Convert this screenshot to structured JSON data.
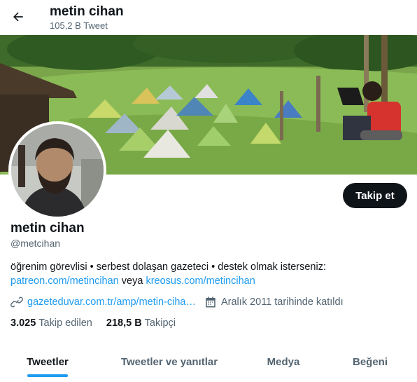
{
  "header": {
    "name": "metin cihan",
    "tweet_count": "105,2 B Tweet"
  },
  "profile": {
    "name": "metin cihan",
    "handle": "@metcihan",
    "follow_label": "Takip et",
    "bio_text": "öğrenim görevlisi • serbest dolaşan gazeteci • destek olmak isterseniz:",
    "bio_link1": "patreon.com/metincihan",
    "bio_connector": " veya ",
    "bio_link2": "kreosus.com/metincihan",
    "website": "gazeteduvar.com.tr/amp/metin-ciha…",
    "joined": "Aralık 2011 tarihinde katıldı",
    "following_count": "3.025",
    "following_label": "Takip edilen",
    "followers_count": "218,5 B",
    "followers_label": "Takipçi"
  },
  "tabs": [
    {
      "label": "Tweetler",
      "active": true
    },
    {
      "label": "Tweetler ve yanıtlar"
    },
    {
      "label": "Medya"
    },
    {
      "label": "Beğeni"
    }
  ],
  "colors": {
    "accent": "#1d9bf0",
    "text": "#0f1419",
    "secondary": "#536471"
  }
}
